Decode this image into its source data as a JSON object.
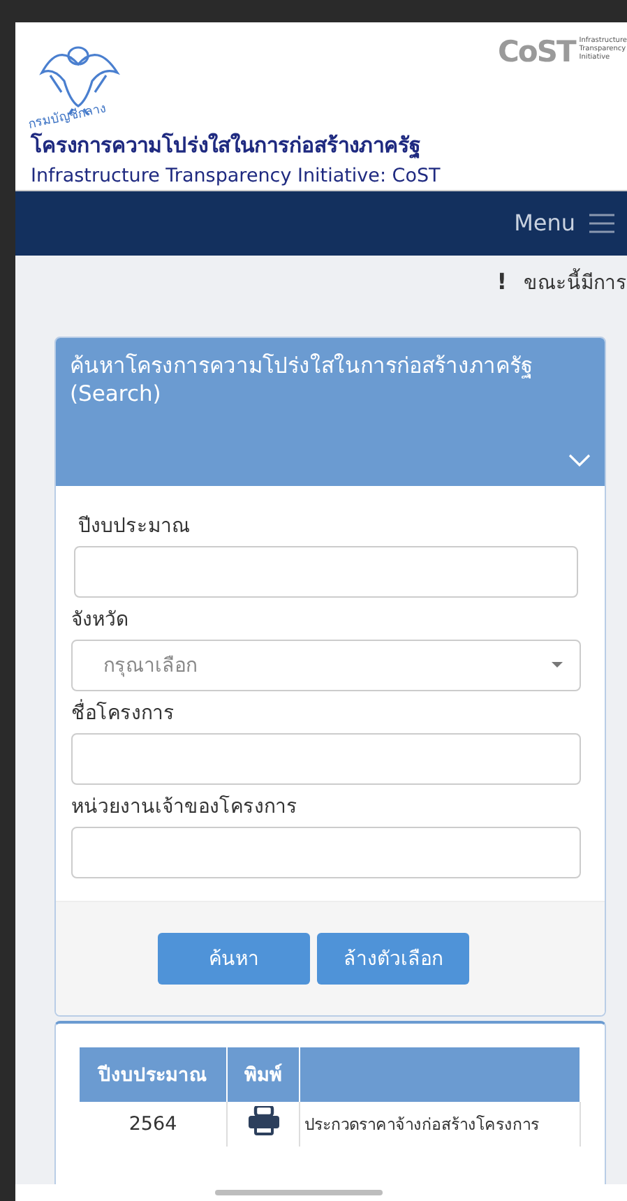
{
  "header": {
    "emblem_caption": "กรมบัญชีกลาง",
    "title": "โครงการความโปร่งใสในการก่อสร้างภาครัฐ",
    "subtitle": "Infrastructure Transparency Initiative: CoST",
    "partner_logo": {
      "wordmark": "CoST",
      "tagline": [
        "Infrastructure",
        "Transparency",
        "Initiative"
      ]
    }
  },
  "nav": {
    "menu_label": "Menu"
  },
  "notice": {
    "mark": "!",
    "text": "ขณะนี้มีการ"
  },
  "search_panel": {
    "title": "ค้นหาโครงการความโปร่งใสในการก่อสร้างภาครัฐ (Search)",
    "expanded": true,
    "fields": [
      {
        "kind": "text",
        "label": "ปีงบประมาณ"
      },
      {
        "kind": "select",
        "label": "จังหวัด",
        "placeholder": "กรุณาเลือก"
      },
      {
        "kind": "text",
        "label": "ชื่อโครงการ"
      },
      {
        "kind": "text",
        "label": "หน่วยงานเจ้าของโครงการ"
      }
    ],
    "buttons": [
      "ค้นหา",
      "ล้างตัวเลือก"
    ]
  },
  "results": {
    "columns": [
      "ปีงบประมาณ",
      "พิมพ์"
    ],
    "rows": [
      {
        "year": "2564",
        "project": "ประกวดราคาจ้างก่อสร้างโครงการ"
      }
    ]
  }
}
